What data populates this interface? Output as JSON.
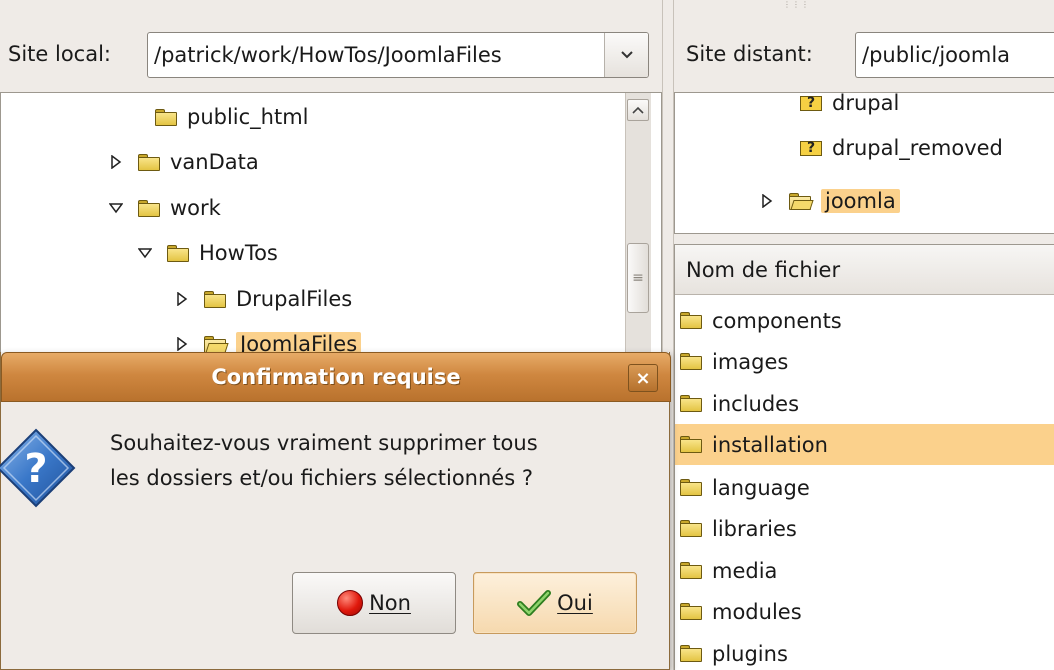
{
  "local": {
    "label": "Site local:",
    "path": "patrick/work/HowTos/JoomlaFiles/",
    "tree": [
      {
        "label": "public_html",
        "expander": "none"
      },
      {
        "label": "vanData",
        "expander": "collapsed"
      },
      {
        "label": "work",
        "expander": "expanded"
      },
      {
        "label": "HowTos",
        "expander": "expanded"
      },
      {
        "label": "DrupalFiles",
        "expander": "collapsed"
      },
      {
        "label": "JoomlaFiles",
        "expander": "collapsed",
        "selected": true
      }
    ]
  },
  "remote": {
    "label": "Site distant:",
    "path": "/public/joomla",
    "tree": [
      {
        "label": "drupal",
        "icon": "unknown-folder-icon"
      },
      {
        "label": "drupal_removed",
        "icon": "unknown-folder-icon"
      },
      {
        "label": "joomla",
        "icon": "open-folder-icon",
        "selected": true
      }
    ],
    "list_header": "Nom de fichier",
    "files": [
      "components",
      "images",
      "includes",
      "installation",
      "language",
      "libraries",
      "media",
      "modules",
      "plugins"
    ],
    "selected_file": "installation"
  },
  "dialog": {
    "title": "Confirmation requise",
    "close": "×",
    "message_line1": "Souhaitez-vous vraiment supprimer tous",
    "message_line2": "les dossiers et/ou fichiers sélectionnés ?",
    "no_label": "Non",
    "yes_label": "Oui"
  },
  "colors": {
    "selection": "#fbd18c",
    "titlebar": "#cf8740"
  }
}
